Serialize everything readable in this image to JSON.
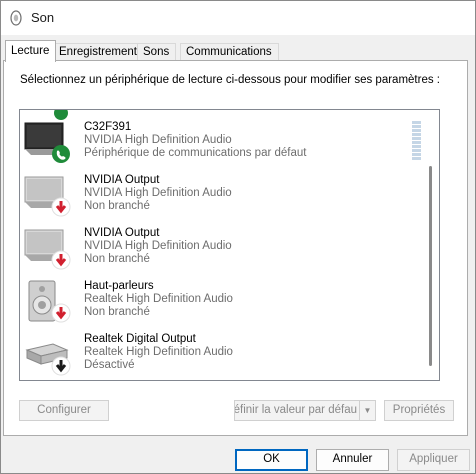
{
  "window": {
    "title": "Son"
  },
  "tabs": [
    {
      "label": "Lecture",
      "active": true
    },
    {
      "label": "Enregistrement",
      "active": false
    },
    {
      "label": "Sons",
      "active": false
    },
    {
      "label": "Communications",
      "active": false
    }
  ],
  "instruction": "Sélectionnez un périphérique de lecture ci-dessous pour modifier ses paramètres :",
  "devices": [
    {
      "name": "C32F391",
      "driver": "NVIDIA High Definition Audio",
      "status": "Périphérique de communications par défaut",
      "icon": "monitor-icon",
      "badge": "phone-badge-green"
    },
    {
      "name": "NVIDIA Output",
      "driver": "NVIDIA High Definition Audio",
      "status": "Non branché",
      "icon": "monitor-icon",
      "badge": "down-arrow-badge-red"
    },
    {
      "name": "NVIDIA Output",
      "driver": "NVIDIA High Definition Audio",
      "status": "Non branché",
      "icon": "monitor-icon",
      "badge": "down-arrow-badge-red"
    },
    {
      "name": "Haut-parleurs",
      "driver": "Realtek High Definition Audio",
      "status": "Non branché",
      "icon": "speaker-icon",
      "badge": "down-arrow-badge-red"
    },
    {
      "name": "Realtek Digital Output",
      "driver": "Realtek High Definition Audio",
      "status": "Désactivé",
      "icon": "digital-output-icon",
      "badge": "down-arrow-badge-black"
    }
  ],
  "buttons": {
    "configure": "Configurer",
    "set_default": "éfinir la valeur par défau",
    "properties": "Propriétés",
    "ok": "OK",
    "cancel": "Annuler",
    "apply": "Appliquer"
  },
  "colors": {
    "accent": "#0067c0",
    "badge_green": "#1f8b3a",
    "badge_red": "#d1202f",
    "badge_black": "#1a1a1a"
  }
}
